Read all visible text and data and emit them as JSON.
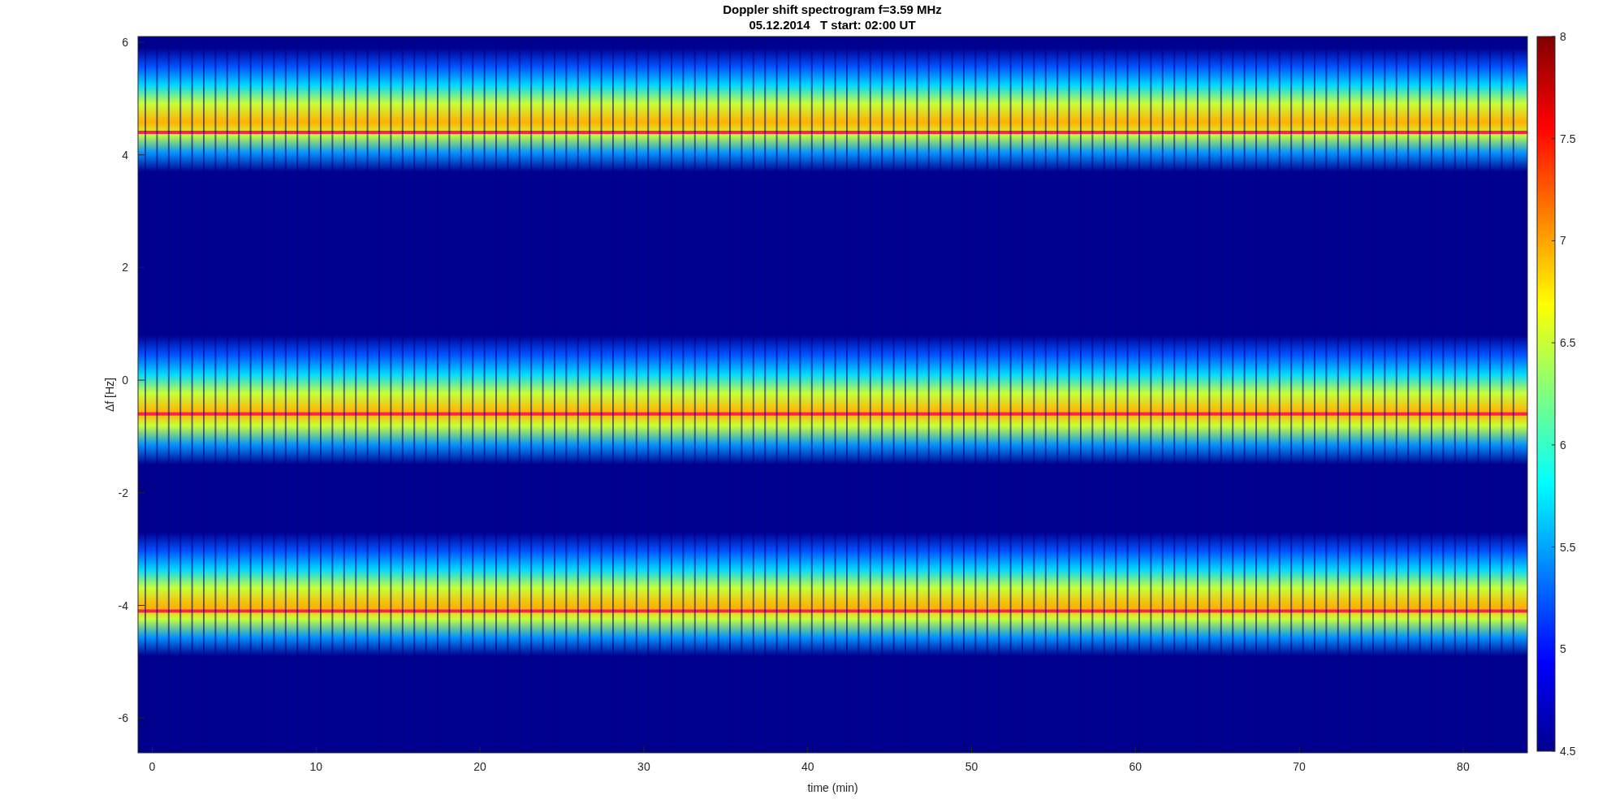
{
  "title": "Doppler shift spectrogram f=3.59 MHz",
  "subtitle": "05.12.2014   T start: 02:00 UT",
  "axes": {
    "xlabel": "time (min)",
    "ylabel": "Δf [Hz]",
    "xticks": [
      "0",
      "10",
      "20",
      "30",
      "40",
      "50",
      "60",
      "70",
      "80"
    ],
    "yticks": [
      "6",
      "4",
      "2",
      "0",
      "-2",
      "-4",
      "-6"
    ]
  },
  "colorbar": {
    "ticks": [
      "8",
      "7.5",
      "7",
      "6.5",
      "6",
      "5.5",
      "5",
      "4.5"
    ]
  }
}
